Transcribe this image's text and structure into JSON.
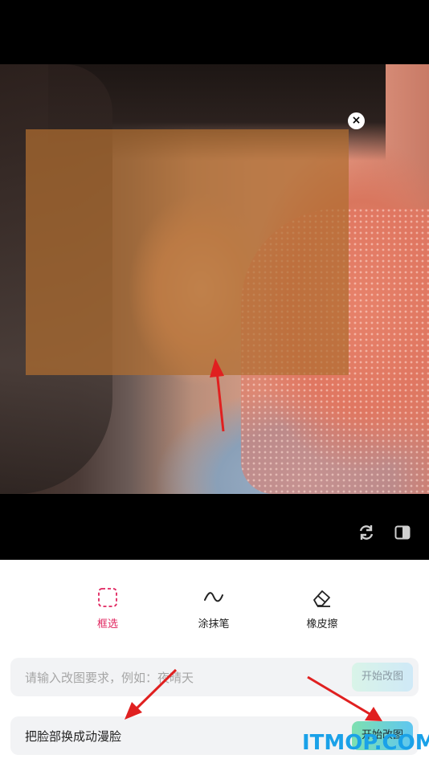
{
  "overlay": {
    "close_label": "×"
  },
  "tools": [
    {
      "label": "框选",
      "icon": "dashed-square-icon",
      "active": true
    },
    {
      "label": "涂抹笔",
      "icon": "wave-icon",
      "active": false
    },
    {
      "label": "橡皮擦",
      "icon": "eraser-icon",
      "active": false
    }
  ],
  "prompt_input": {
    "placeholder": "请输入改图要求，例如：夜晴天",
    "button_label": "开始改图"
  },
  "prompt_result": {
    "text": "把脸部换成动漫脸",
    "button_label": "开始改图"
  },
  "toolbar_icons": [
    "refresh-icon",
    "compare-icon"
  ],
  "watermark": "ITMOP.COM",
  "colors": {
    "accent": "#e0245e",
    "selection": "#b06e30",
    "arrow": "#e02020"
  }
}
